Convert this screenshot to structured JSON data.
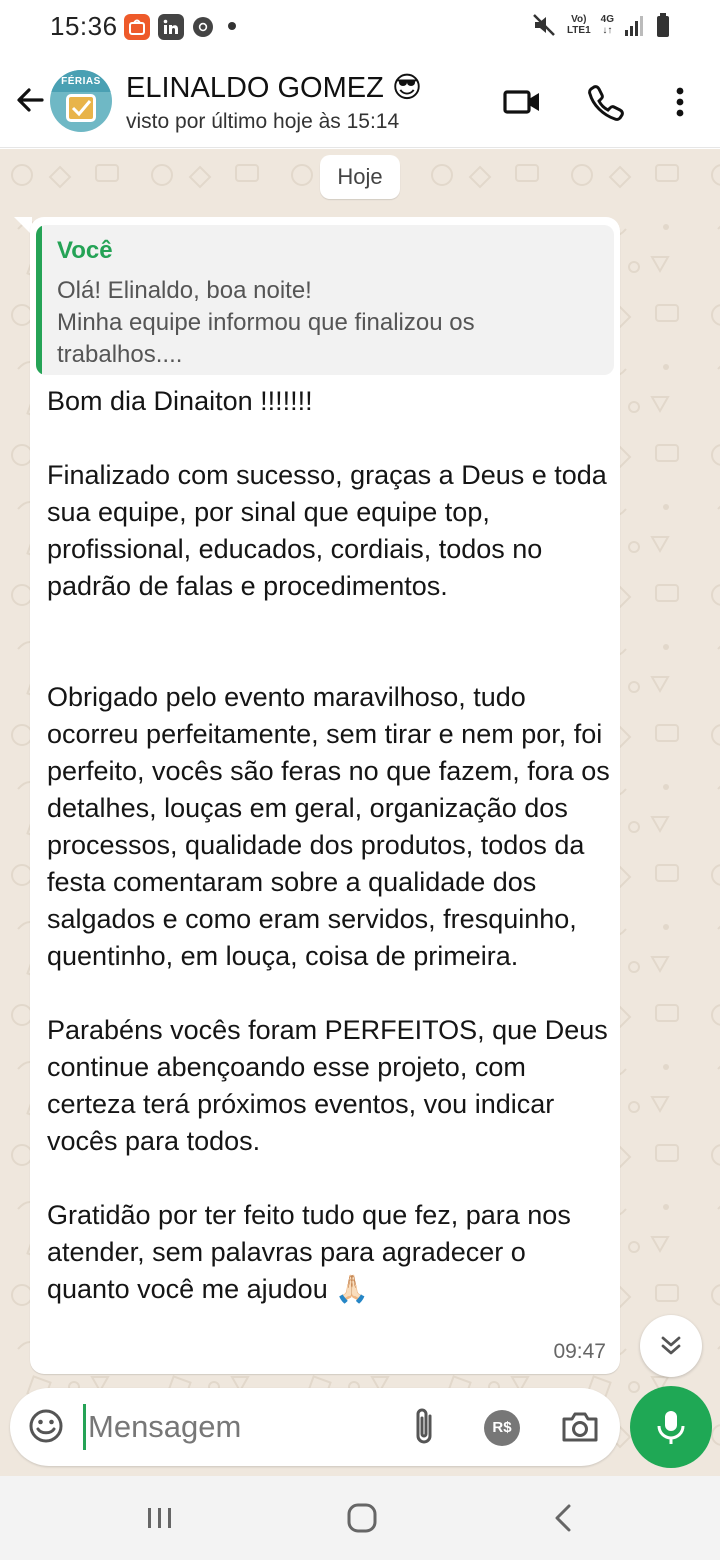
{
  "status_bar": {
    "time": "15:36",
    "network_top": "Vo)",
    "network_bottom": "LTE1",
    "signal_type": "4G",
    "icons": [
      "shopee-icon",
      "linkedin-icon",
      "chrome-icon",
      "mute-icon",
      "signal-icon",
      "battery-icon"
    ]
  },
  "header": {
    "contact_name": "ELINALDO GOMEZ 😎",
    "last_seen": "visto por último hoje às 15:14",
    "avatar_label": "FÉRIAS",
    "icons": [
      "back-arrow-icon",
      "video-call-icon",
      "phone-call-icon",
      "more-vert-icon"
    ]
  },
  "chat": {
    "date_divider": "Hoje",
    "message": {
      "quote_author": "Você",
      "quote_text": "Olá! Elinaldo, boa noite!\nMinha equipe informou que finalizou os trabalhos....",
      "text": "Bom dia Dinaiton !!!!!!!\n\nFinalizado com sucesso, graças a Deus e toda sua equipe, por sinal que equipe top, profissional, educados, cordiais, todos no padrão de falas e procedimentos.\n\n\nObrigado pelo evento maravilhoso, tudo ocorreu perfeitamente, sem tirar e nem por, foi perfeito, vocês são feras no que fazem, fora os detalhes, louças em geral, organização dos processos, qualidade dos produtos, todos da festa comentaram sobre a qualidade dos salgados e como eram servidos, fresquinho, quentinho, em louça, coisa de primeira.\n\nParabéns vocês foram PERFEITOS, que Deus continue abençoando esse projeto, com certeza terá próximos eventos, vou indicar vocês para todos.\n\nGratidão por ter feito tudo que fez, para nos atender, sem palavras para agradecer o quanto você me ajudou 🙏🏻",
      "time": "09:47"
    }
  },
  "composer": {
    "placeholder": "Mensagem",
    "value": "",
    "pay_label": "R$",
    "icons": [
      "emoji-icon",
      "attach-icon",
      "payment-icon",
      "camera-icon",
      "mic-icon"
    ]
  },
  "colors": {
    "accent_green": "#1fa855",
    "quote_green": "#25a356",
    "chat_background": "#efe7dd"
  }
}
